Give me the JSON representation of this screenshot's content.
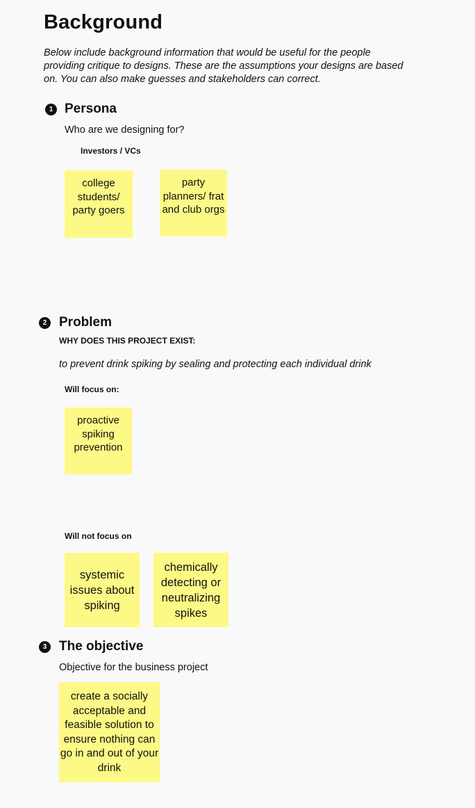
{
  "title": "Background",
  "intro": "Below include background information that would be useful for the people providing critique to designs. These are the assumptions your designs are based on. You can also make guesses and stakeholders can correct.",
  "persona": {
    "number": "1",
    "heading": "Persona",
    "question": "Who are we designing for?",
    "group_label": "Investors / VCs",
    "notes": [
      "college students/ party goers",
      "party planners/ frat and club orgs"
    ]
  },
  "problem": {
    "number": "2",
    "heading": "Problem",
    "why_label": "WHY DOES THIS PROJECT EXIST:",
    "statement": "to prevent drink spiking by sealing and protecting each individual drink",
    "focus_label": "Will focus on:",
    "focus_notes": [
      "proactive spiking prevention"
    ],
    "not_focus_label": "Will not focus on",
    "not_focus_notes": [
      "systemic issues about spiking",
      "chemically detecting or neutralizing spikes"
    ]
  },
  "objective": {
    "number": "3",
    "heading": "The objective",
    "description": "Objective for the business project",
    "notes": [
      "create a socially acceptable and feasible solution to ensure nothing can go in and out of your drink"
    ]
  },
  "colors": {
    "sticky_note": "#fdf986",
    "background": "#f9f9f9"
  }
}
